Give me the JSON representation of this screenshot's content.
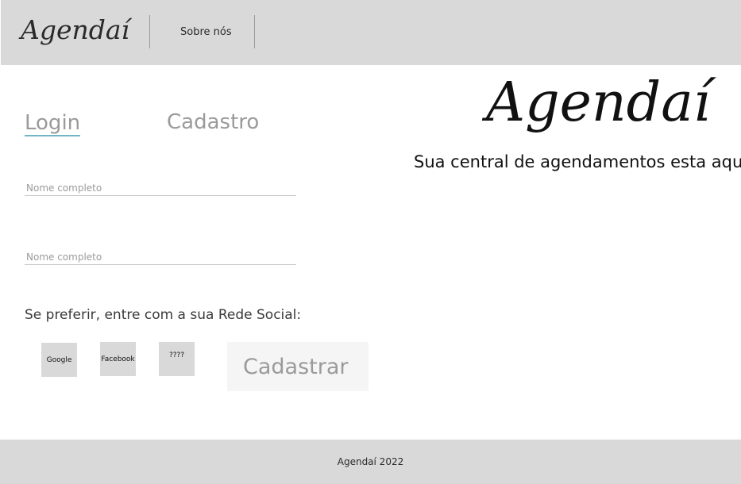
{
  "header": {
    "logo": "Agendaí",
    "nav_about": "Sobre nós"
  },
  "tabs": {
    "login": "Login",
    "cadastro": "Cadastro"
  },
  "form": {
    "field1_placeholder": "Nome completo",
    "field2_placeholder": "Nome completo",
    "social_prompt": "Se preferir, entre com a sua Rede Social:",
    "social": {
      "google": "Google",
      "facebook": "Facebook",
      "other": "????"
    },
    "submit_label": "Cadastrar"
  },
  "hero": {
    "logo": "Agendaí",
    "tagline": "Sua central de agendamentos esta aqui"
  },
  "footer": {
    "text": "Agendaí 2022"
  },
  "colors": {
    "header_bg": "#d9d9d9",
    "tab_underline": "#6fb7c4",
    "muted_text": "#9a9a9a"
  }
}
